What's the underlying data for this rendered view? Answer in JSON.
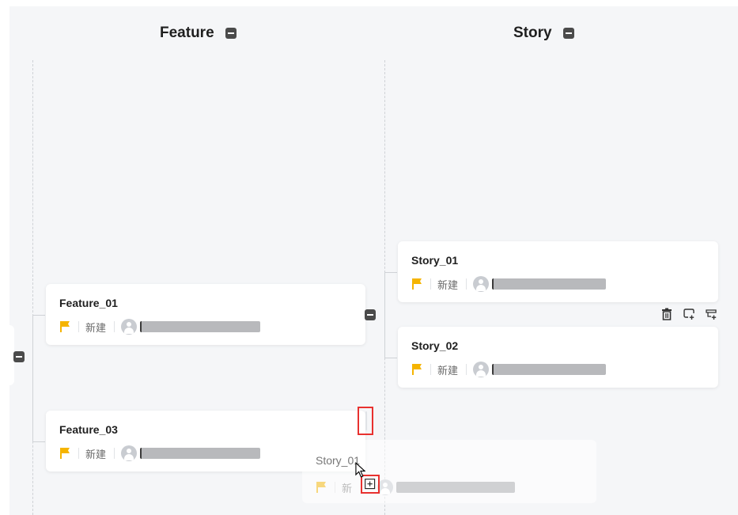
{
  "columns": [
    {
      "title": "Feature"
    },
    {
      "title": "Story"
    }
  ],
  "features": [
    {
      "name": "Feature_01",
      "status": "新建"
    },
    {
      "name": "Feature_03",
      "status": "新建"
    }
  ],
  "stories": [
    {
      "name": "Story_01",
      "status": "新建"
    },
    {
      "name": "Story_02",
      "status": "新建"
    }
  ],
  "drag_ghost": {
    "name": "Story_01",
    "status": "新"
  },
  "colors": {
    "flag": "#f5b400",
    "highlight": "#e8312f",
    "board_bg": "#f5f6f8"
  },
  "icons": {
    "collapse": "minus-square-icon",
    "flag": "flag-icon",
    "avatar": "user-avatar-icon",
    "actions": [
      "trash-icon",
      "add-sibling-icon",
      "add-child-icon"
    ],
    "drop_target": "plus-square-icon"
  }
}
